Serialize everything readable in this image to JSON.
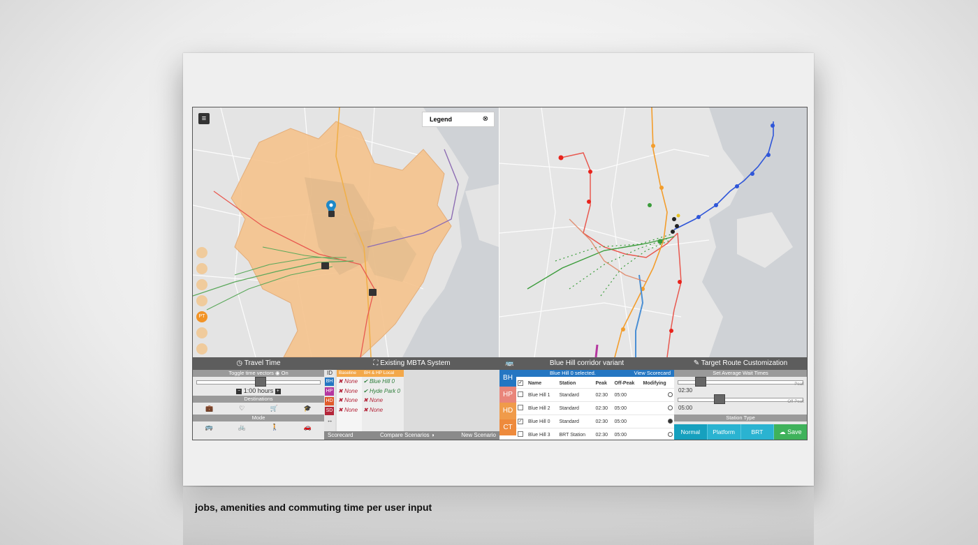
{
  "legend": {
    "title": "Legend",
    "close_icon": "close-icon"
  },
  "travel_time": {
    "title": "Travel Time",
    "toggle_label": "Toggle time vectors",
    "toggle_state": "On",
    "slider_value": 0.52,
    "hours_label": "1:00 hours",
    "destinations_label": "Destinations",
    "destination_icons": [
      "briefcase-icon",
      "heart-icon",
      "cart-icon",
      "graduation-icon"
    ],
    "mode_label": "Mode",
    "mode_icons": [
      "bus-icon",
      "bike-icon",
      "walk-icon",
      "car-icon"
    ]
  },
  "side_icons": [
    {
      "label": ""
    },
    {
      "label": ""
    },
    {
      "label": ""
    },
    {
      "label": ""
    },
    {
      "label": "PT"
    },
    {
      "label": ""
    },
    {
      "label": ""
    }
  ],
  "scenarios": {
    "title": "Existing MBTA System",
    "id_header": "ID",
    "baseline_header": "Baseline",
    "bh_header": "BH & HP Local",
    "ids": [
      {
        "id": "BH",
        "color": "#2476c2"
      },
      {
        "id": "HP",
        "color": "#b537a0"
      },
      {
        "id": "HD",
        "color": "#e05a2a"
      },
      {
        "id": "SD",
        "color": "#b4263a"
      }
    ],
    "baseline": [
      "None",
      "None",
      "None",
      "None"
    ],
    "bh_local": [
      "Blue Hill 0",
      "Hyde Park 0",
      "None",
      "None"
    ],
    "bh_local_ok": [
      true,
      true,
      false,
      false
    ],
    "footer": {
      "scorecard": "Scorecard",
      "compare": "Compare Scenarios",
      "new": "New Scenario"
    }
  },
  "corridor": {
    "title": "Blue Hill corridor variant",
    "selected_text": "Blue Hill 0 selected.",
    "view_scorecard": "View Scorecard",
    "route_tabs": [
      {
        "label": "BH",
        "color": "#2476c2"
      },
      {
        "label": "HP",
        "color": "#e9857a"
      },
      {
        "label": "HD",
        "color": "#f09b4a"
      },
      {
        "label": "CT",
        "color": "#ee8a3c"
      }
    ],
    "columns": [
      "Name",
      "Station",
      "Peak",
      "Off-Peak",
      "Modifying"
    ],
    "rows": [
      {
        "name": "Blue Hill 1",
        "station": "Standard",
        "peak": "02:30",
        "offpeak": "05:00",
        "checked": false,
        "modifying": false
      },
      {
        "name": "Blue Hill 2",
        "station": "Standard",
        "peak": "02:30",
        "offpeak": "05:00",
        "checked": false,
        "modifying": false
      },
      {
        "name": "Blue Hill 0",
        "station": "Standard",
        "peak": "02:30",
        "offpeak": "05:00",
        "checked": true,
        "modifying": true
      },
      {
        "name": "Blue Hill 3",
        "station": "BRT Station",
        "peak": "02:30",
        "offpeak": "05:00",
        "checked": false,
        "modifying": false
      }
    ]
  },
  "customization": {
    "title": "Target Route Customization",
    "wait_times_label": "Set Average Wait Times",
    "peak_value": "02:30",
    "peak_label": "Peak",
    "peak_slider": 0.15,
    "offpeak_value": "05:00",
    "offpeak_label": "Off-Peak",
    "offpeak_slider": 0.32,
    "station_type_label": "Station Type",
    "station_types": [
      "Normal",
      "Platform",
      "BRT"
    ],
    "save_label": "Save"
  },
  "caption": "jobs, amenities and commuting time per user input"
}
